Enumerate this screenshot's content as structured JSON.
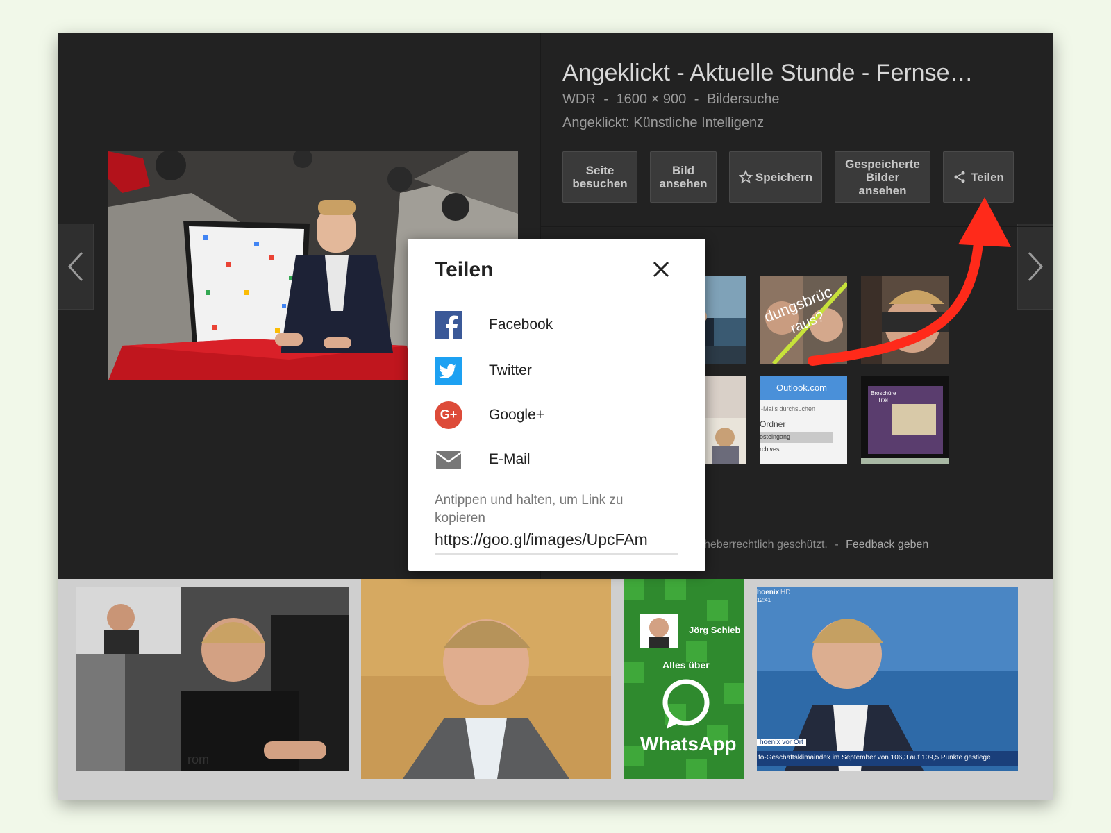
{
  "result": {
    "title": "Angeklickt - Aktuelle Stunde - Fernse…",
    "source": "WDR",
    "dimensions": "1600 × 900",
    "search_type": "Bildersuche",
    "separator": "-",
    "description": "Angeklickt: Künstliche Intelligenz"
  },
  "actions": {
    "visit_line1": "Seite",
    "visit_line2": "besuchen",
    "view_line1": "Bild",
    "view_line2": "ansehen",
    "save_label": "Speichern",
    "saved_line1": "Gespeicherte",
    "saved_line2": "Bilder",
    "saved_line3": "ansehen",
    "share_label": "Teilen"
  },
  "footer": {
    "copyright": "heberrechtlich geschützt.",
    "separator": "-",
    "feedback": "Feedback geben"
  },
  "related_thumbs": {
    "t2_text": "dungsbrüc",
    "t2_text2": "raus?",
    "t5_header": "Outlook.com",
    "t5_search": "-Mails durchsuchen",
    "t5_folder": "Ordner",
    "t5_inbox": "osteingang",
    "t5_archive": "rchives",
    "t6_title": "Broschüre",
    "t6_sub": "Titel"
  },
  "strip": {
    "img3_name": "Jörg Schieb",
    "img3_line1": "Alles über",
    "img3_brand": "WhatsApp",
    "img4_logo": "hoenix",
    "img4_hd": "HD",
    "img4_time": "12:41",
    "img4_tag": "hoenix vor Ort",
    "img4_ticker": "fo-Geschäftsklimaindex im September von 106,3 auf 109,5 Punkte gestiege",
    "img1_shirt": "rom"
  },
  "share_dialog": {
    "title": "Teilen",
    "options": [
      {
        "label": "Facebook",
        "icon": "facebook-icon"
      },
      {
        "label": "Twitter",
        "icon": "twitter-icon"
      },
      {
        "label": "Google+",
        "icon": "google-plus-icon"
      },
      {
        "label": "E-Mail",
        "icon": "mail-icon"
      }
    ],
    "google_glyph": "G+",
    "hint": "Antippen und halten, um Link zu kopieren",
    "link": "https://goo.gl/images/UpcFAm"
  },
  "colors": {
    "page_bg": "#f1f8e9",
    "dark_bg": "#222222",
    "button_bg": "#3a3a3a",
    "facebook": "#3b5998",
    "twitter": "#1da1f2",
    "google": "#dd4b39",
    "annotation_arrow": "#ff2a1a"
  }
}
